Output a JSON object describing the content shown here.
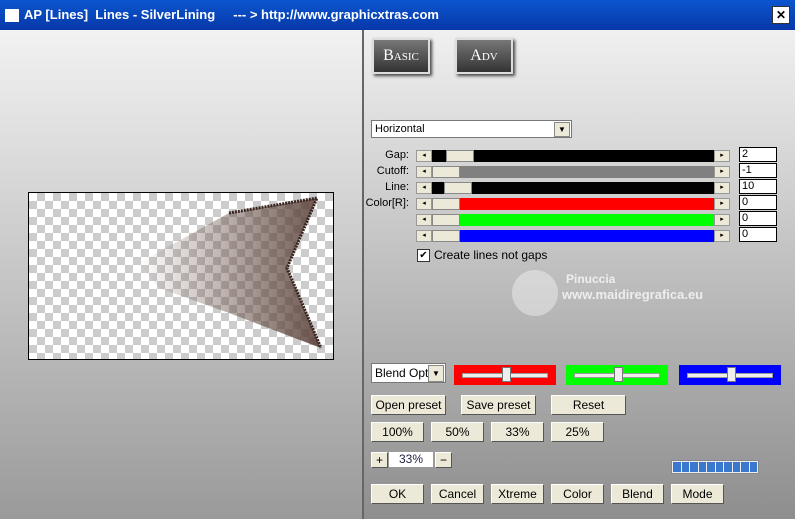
{
  "window": {
    "title": "AP [Lines]  Lines - SilverLining     --- > http://www.graphicxtras.com",
    "close": "✕"
  },
  "tabs": {
    "basic": "Basic",
    "adv": "Adv"
  },
  "direction": {
    "selected": "Horizontal"
  },
  "sliders": [
    {
      "label": "Gap:",
      "value": "2",
      "color": "#000000"
    },
    {
      "label": "Cutoff:",
      "value": "-1",
      "color": "#808080"
    },
    {
      "label": "Line:",
      "value": "10",
      "color": "#000000"
    },
    {
      "label": "Color[R]:",
      "value": "0",
      "color": "#ff0000"
    },
    {
      "label": "",
      "value": "0",
      "color": "#00ff00"
    },
    {
      "label": "",
      "value": "0",
      "color": "#0000ff"
    }
  ],
  "checkbox": {
    "label": "Create lines not gaps",
    "checked": true
  },
  "watermark": {
    "name": "Pinuccia",
    "url": "www.maidiregrafica.eu"
  },
  "blend": {
    "selected": "Blend Opti",
    "rgb_sliders": [
      {
        "color": "#ff0000",
        "level": 0.5
      },
      {
        "color": "#00ff00",
        "level": 0.5
      },
      {
        "color": "#0000ff",
        "level": 0.5
      }
    ]
  },
  "buttons": {
    "open": "Open preset",
    "save": "Save preset",
    "reset": "Reset",
    "z100": "100%",
    "z50": "50%",
    "z33": "33%",
    "z25": "25%",
    "plus": "+",
    "minus": "−",
    "zoom": "33%",
    "ok": "OK",
    "cancel": "Cancel",
    "xtreme": "Xtreme",
    "color": "Color",
    "blend": "Blend",
    "mode": "Mode"
  },
  "progress": {
    "segments": 10,
    "filled": 10
  }
}
